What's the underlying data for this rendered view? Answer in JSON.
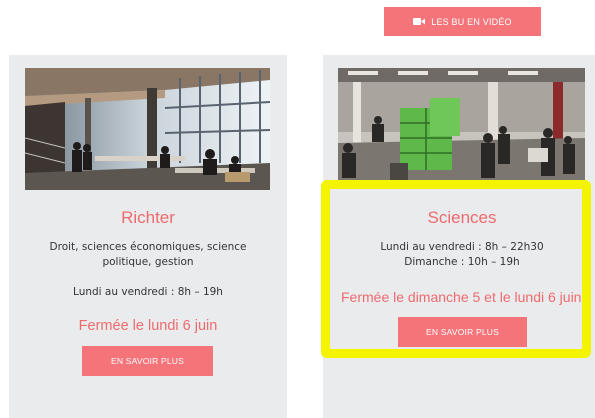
{
  "header": {
    "video_button_label": "LES BU EN VIDÉO"
  },
  "libraries": [
    {
      "name": "Richter",
      "subjects_line1": "Droit, sciences économiques, science",
      "subjects_line2": "politique, gestion",
      "hours_line1": "Lundi au vendredi : 8h – 19h",
      "closure": "Fermée le lundi 6 juin",
      "more_label": "EN SAVOIR PLUS"
    },
    {
      "name": "Sciences",
      "hours_line1": "Lundi au vendredi : 8h – 22h30",
      "hours_line2": "Dimanche : 10h – 19h",
      "closure": "Fermée le dimanche 5 et le lundi 6 juin",
      "more_label": "EN SAVOIR PLUS"
    }
  ],
  "colors": {
    "accent": "#f4747a",
    "title": "#ef6a6f",
    "card_bg": "#e9ebec",
    "highlight": "#f4f400"
  },
  "icons": {
    "video": "video-camera-icon"
  }
}
